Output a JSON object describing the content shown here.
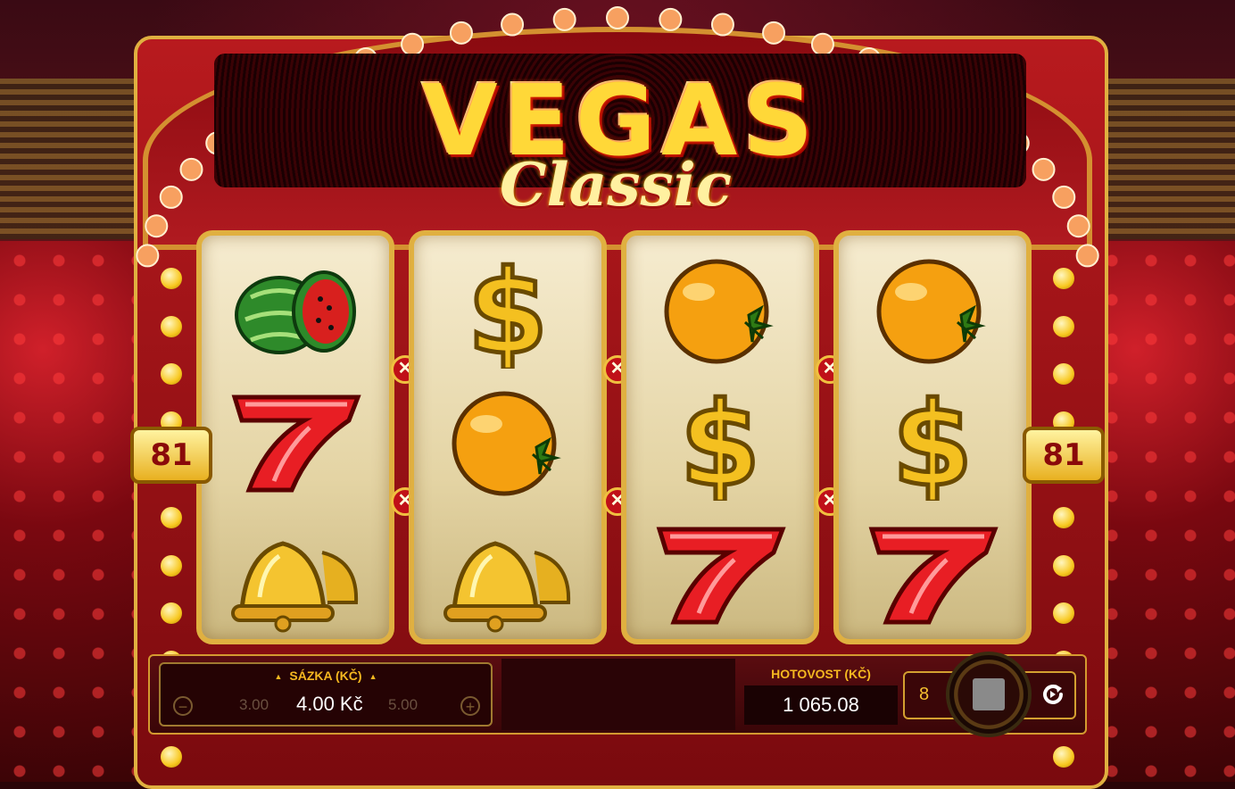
{
  "game": {
    "logo_text": "VEGAS",
    "subtitle": "Classic"
  },
  "paylines": {
    "left": "81",
    "right": "81"
  },
  "reels": [
    [
      "watermelon",
      "seven",
      "bell"
    ],
    [
      "dollar",
      "orange",
      "bell"
    ],
    [
      "orange",
      "dollar",
      "seven"
    ],
    [
      "orange",
      "dollar",
      "seven"
    ]
  ],
  "bet": {
    "label": "SÁZKA (KČ)",
    "prev": "3.00",
    "current": "4.00 Kč",
    "next": "5.00",
    "minus": "−",
    "plus": "+"
  },
  "cash": {
    "label": "HOTOVOST (KČ)",
    "value": "1 065.08"
  },
  "autoplay": {
    "count": "8"
  },
  "icons": {
    "decrease": "minus-circle-icon",
    "increase": "plus-circle-icon",
    "spin": "stop-square-icon",
    "reload": "reload-icon"
  },
  "colors": {
    "accent_gold": "#f5b820",
    "cabinet_red": "#b81a1e",
    "panel_bg": "#3a0608"
  }
}
